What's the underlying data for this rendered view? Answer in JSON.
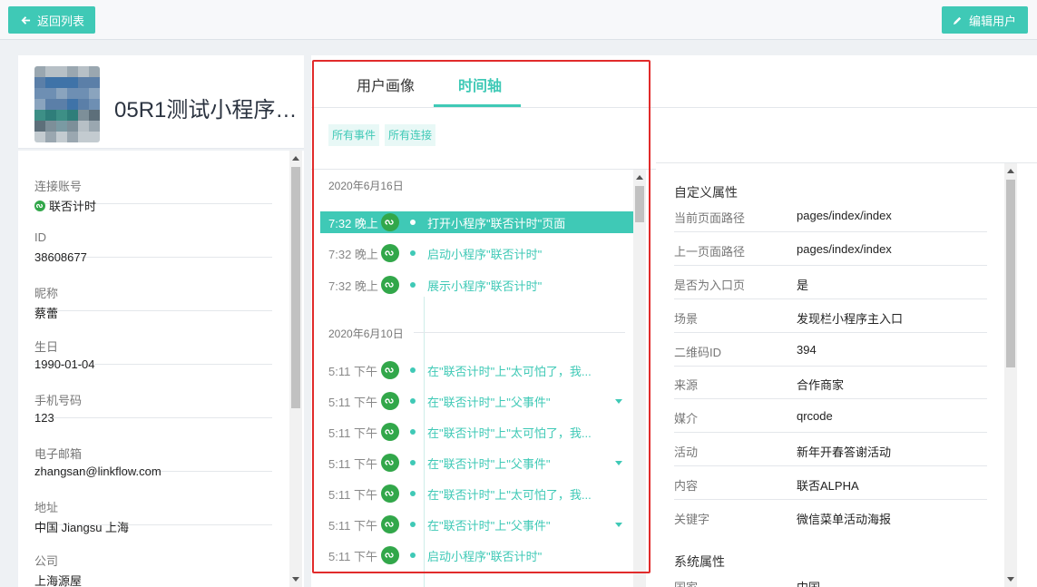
{
  "header": {
    "back_label": "返回列表",
    "edit_label": "编辑用户"
  },
  "profile": {
    "name": "05R1测试小程序…"
  },
  "fields": [
    {
      "label": "连接账号",
      "value": "联否计时"
    },
    {
      "label": "ID",
      "value": "38608677"
    },
    {
      "label": "昵称",
      "value": "蔡蕾"
    },
    {
      "label": "生日",
      "value": "1990-01-04"
    },
    {
      "label": "手机号码",
      "value": "123"
    },
    {
      "label": "电子邮箱",
      "value": "zhangsan@linkflow.com"
    },
    {
      "label": "地址",
      "value": "中国 Jiangsu 上海"
    },
    {
      "label": "公司",
      "value": "上海源屋"
    }
  ],
  "tabs": [
    {
      "label": "用户画像"
    },
    {
      "label": "时间轴"
    }
  ],
  "filters": [
    "所有事件",
    "所有连接"
  ],
  "timeline": {
    "groups": [
      {
        "date": "2020年6月16日",
        "events": [
          {
            "time": "7:32 晚上",
            "text": "打开小程序\"联否计时\"页面"
          },
          {
            "time": "7:32 晚上",
            "text": "启动小程序\"联否计时\""
          },
          {
            "time": "7:32 晚上",
            "text": "展示小程序\"联否计时\""
          }
        ]
      },
      {
        "date": "2020年6月10日",
        "events": [
          {
            "time": "5:11 下午",
            "text": "在\"联否计时\"上\"太可怕了，我..."
          },
          {
            "time": "5:11 下午",
            "text": "在\"联否计时\"上\"父事件\""
          },
          {
            "time": "5:11 下午",
            "text": "在\"联否计时\"上\"太可怕了，我..."
          },
          {
            "time": "5:11 下午",
            "text": "在\"联否计时\"上\"父事件\""
          },
          {
            "time": "5:11 下午",
            "text": "在\"联否计时\"上\"太可怕了，我..."
          },
          {
            "time": "5:11 下午",
            "text": "在\"联否计时\"上\"父事件\""
          },
          {
            "time": "5:11 下午",
            "text": "启动小程序\"联否计时\""
          }
        ]
      }
    ]
  },
  "attributes": {
    "custom_title": "自定义属性",
    "custom": [
      {
        "key": "当前页面路径",
        "value": "pages/index/index"
      },
      {
        "key": "上一页面路径",
        "value": "pages/index/index"
      },
      {
        "key": "是否为入口页",
        "value": "是"
      },
      {
        "key": "场景",
        "value": "发现栏小程序主入口"
      },
      {
        "key": "二维码ID",
        "value": "394"
      },
      {
        "key": "来源",
        "value": "合作商家"
      },
      {
        "key": "媒介",
        "value": "qrcode"
      },
      {
        "key": "活动",
        "value": "新年开春答谢活动"
      },
      {
        "key": "内容",
        "value": "联否ALPHA"
      },
      {
        "key": "关键字",
        "value": "微信菜单活动海报"
      }
    ],
    "system_title": "系统属性",
    "system": [
      {
        "key": "国家",
        "value": "中国"
      }
    ]
  },
  "colors": {
    "accent": "#3fc9b6",
    "miniprogram_green": "#32a74a",
    "highlight_border": "#e12b2b"
  }
}
